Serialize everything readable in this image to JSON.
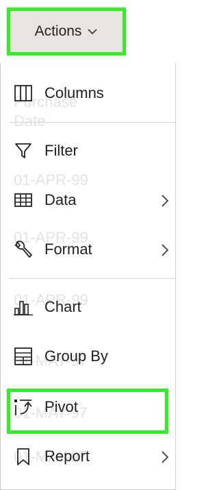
{
  "toolbar": {
    "actions_label": "Actions"
  },
  "menu": {
    "items": [
      {
        "label": "Columns",
        "icon": "columns-icon",
        "submenu": false
      },
      {
        "label": "Filter",
        "icon": "filter-icon",
        "submenu": false
      },
      {
        "label": "Data",
        "icon": "data-table-icon",
        "submenu": true
      },
      {
        "label": "Format",
        "icon": "wrench-icon",
        "submenu": true
      },
      {
        "label": "Chart",
        "icon": "bar-chart-icon",
        "submenu": false
      },
      {
        "label": "Group By",
        "icon": "group-by-icon",
        "submenu": false
      },
      {
        "label": "Pivot",
        "icon": "pivot-icon",
        "submenu": false
      },
      {
        "label": "Report",
        "icon": "bookmark-icon",
        "submenu": true
      }
    ]
  },
  "background_report": {
    "column_header_line1": "Purchase",
    "column_header_line2": "Date",
    "rows": [
      "01-APR-99",
      "01-APR-99",
      "01-APR-99",
      "01-MAY-97",
      "01-MAY-97",
      "01-MAY-97"
    ]
  },
  "colors": {
    "highlight": "#33ee22",
    "button_bg": "#e8e5e0"
  }
}
